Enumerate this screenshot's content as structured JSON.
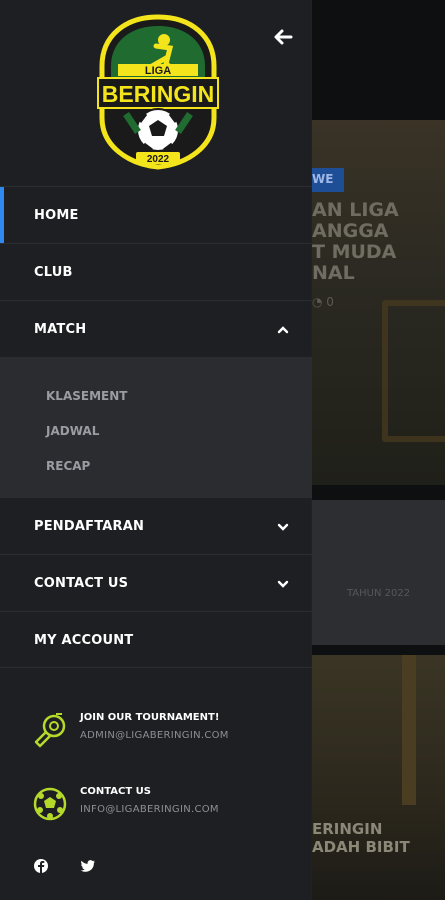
{
  "background": {
    "tag": "WE",
    "headline": "AN LIGA\nANGGA\nT MUDA\nNAL",
    "card_text": "TAHUN 2022",
    "photo_headline": "ERINGIN\nADAH BIBIT"
  },
  "brand": {
    "logo_top": "LIGA",
    "logo_main": "BERINGIN",
    "logo_year": "2022",
    "accent": "#2f89f0",
    "logo_yellow": "#f4e41c"
  },
  "drawer": {
    "back_icon": "arrow-left-icon",
    "menu": [
      {
        "label": "HOME"
      },
      {
        "label": "CLUB"
      },
      {
        "label": "MATCH"
      },
      {
        "label": "PENDAFTARAN"
      },
      {
        "label": "CONTACT US"
      },
      {
        "label": "MY ACCOUNT"
      }
    ],
    "submenu": [
      {
        "label": "KLASEMENT"
      },
      {
        "label": "JADWAL"
      },
      {
        "label": "RECAP"
      }
    ],
    "info": [
      {
        "title": "JOIN OUR TOURNAMENT!",
        "value": "ADMIN@LIGABERINGIN.COM",
        "icon": "whistle-icon"
      },
      {
        "title": "CONTACT US",
        "value": "INFO@LIGABERINGIN.COM",
        "icon": "soccer-ball-icon"
      }
    ],
    "social": [
      "facebook-icon",
      "twitter-icon"
    ],
    "icon_color": "#b5d92a"
  }
}
